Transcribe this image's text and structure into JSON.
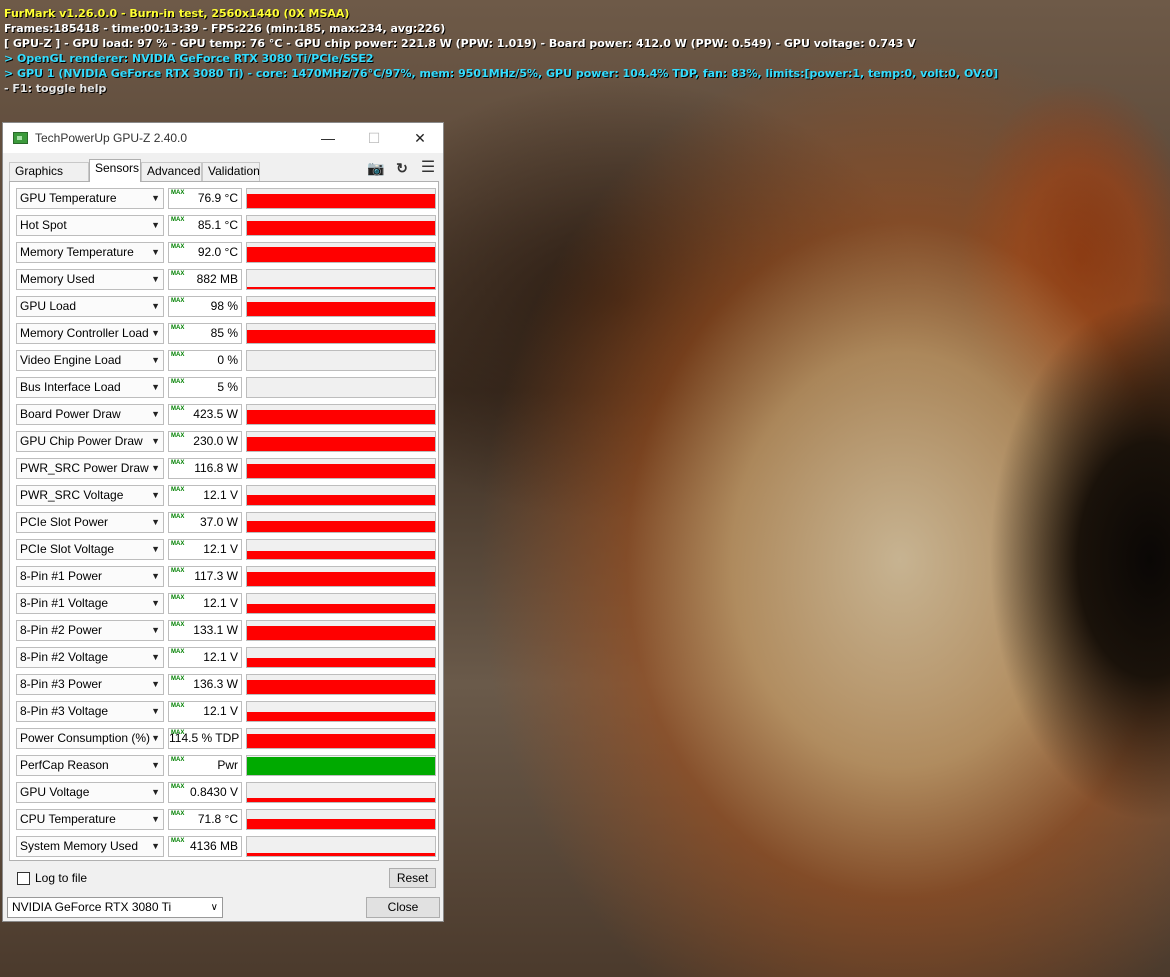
{
  "overlay": {
    "line1": "FurMark v1.26.0.0 - Burn-in test, 2560x1440 (0X MSAA)",
    "line2": "Frames:185418 - time:00:13:39 - FPS:226 (min:185, max:234, avg:226)",
    "line3": "[ GPU-Z ] - GPU load: 97 % - GPU temp: 76 °C - GPU chip power: 221.8 W (PPW: 1.019) - Board power: 412.0 W (PPW: 0.549) - GPU voltage: 0.743 V",
    "line4": "> OpenGL renderer: NVIDIA GeForce RTX 3080 Ti/PCIe/SSE2",
    "line5": "> GPU 1 (NVIDIA GeForce RTX 3080 Ti) - core: 1470MHz/76°C/97%, mem: 9501MHz/5%, GPU power: 104.4% TDP, fan: 83%, limits:[power:1, temp:0, volt:0, OV:0]",
    "line6": "- F1: toggle help"
  },
  "window": {
    "title": "TechPowerUp GPU-Z 2.40.0",
    "min_glyph": "—",
    "max_glyph": "☐",
    "close_glyph": "✕"
  },
  "tabs": [
    "Graphics Card",
    "Sensors",
    "Advanced",
    "Validation"
  ],
  "toolbar": {
    "camera": "📷",
    "refresh": "↻",
    "menu": "☰"
  },
  "max_label": "MAX",
  "sensors": [
    {
      "name": "GPU Temperature",
      "value": "76.9 °C",
      "level": 0.75,
      "color": "#ff0000"
    },
    {
      "name": "Hot Spot",
      "value": "85.1 °C",
      "level": 0.75,
      "color": "#ff0000"
    },
    {
      "name": "Memory Temperature",
      "value": "92.0 °C",
      "level": 0.8,
      "color": "#ff0000"
    },
    {
      "name": "Memory Used",
      "value": "882 MB",
      "level": 0.1,
      "color": "#ff0000"
    },
    {
      "name": "GPU Load",
      "value": "98 %",
      "level": 0.75,
      "color": "#ff0000"
    },
    {
      "name": "Memory Controller Load",
      "value": "85 %",
      "level": 0.7,
      "color": "#ff0000"
    },
    {
      "name": "Video Engine Load",
      "value": "0 %",
      "level": 0,
      "color": "#ff0000"
    },
    {
      "name": "Bus Interface Load",
      "value": "5 %",
      "level": 0,
      "color": "#ff0000"
    },
    {
      "name": "Board Power Draw",
      "value": "423.5 W",
      "level": 0.75,
      "color": "#ff0000"
    },
    {
      "name": "GPU Chip Power Draw",
      "value": "230.0 W",
      "level": 0.75,
      "color": "#ff0000"
    },
    {
      "name": "PWR_SRC Power Draw",
      "value": "116.8 W",
      "level": 0.75,
      "color": "#ff0000"
    },
    {
      "name": "PWR_SRC Voltage",
      "value": "12.1 V",
      "level": 0.55,
      "color": "#ff0000"
    },
    {
      "name": "PCIe Slot Power",
      "value": "37.0 W",
      "level": 0.6,
      "color": "#ff0000"
    },
    {
      "name": "PCIe Slot Voltage",
      "value": "12.1 V",
      "level": 0.4,
      "color": "#ff0000"
    },
    {
      "name": "8-Pin #1 Power",
      "value": "117.3 W",
      "level": 0.75,
      "color": "#ff0000"
    },
    {
      "name": "8-Pin #1 Voltage",
      "value": "12.1 V",
      "level": 0.45,
      "color": "#ff0000"
    },
    {
      "name": "8-Pin #2 Power",
      "value": "133.1 W",
      "level": 0.75,
      "color": "#ff0000"
    },
    {
      "name": "8-Pin #2 Voltage",
      "value": "12.1 V",
      "level": 0.45,
      "color": "#ff0000"
    },
    {
      "name": "8-Pin #3 Power",
      "value": "136.3 W",
      "level": 0.75,
      "color": "#ff0000"
    },
    {
      "name": "8-Pin #3 Voltage",
      "value": "12.1 V",
      "level": 0.45,
      "color": "#ff0000"
    },
    {
      "name": "Power Consumption (%)",
      "value": "114.5 % TDP",
      "level": 0.75,
      "color": "#ff0000"
    },
    {
      "name": "PerfCap Reason",
      "value": "Pwr",
      "level": 0.95,
      "color": "#00aa00"
    },
    {
      "name": "GPU Voltage",
      "value": "0.8430 V",
      "level": 0.2,
      "color": "#ff0000"
    },
    {
      "name": "CPU Temperature",
      "value": "71.8 °C",
      "level": 0.5,
      "color": "#ff0000"
    },
    {
      "name": "System Memory Used",
      "value": "4136 MB",
      "level": 0.15,
      "color": "#ff0000"
    }
  ],
  "bottom": {
    "log_label": "Log to file",
    "reset_label": "Reset",
    "gpu_selected": "NVIDIA GeForce RTX 3080 Ti",
    "close_label": "Close"
  }
}
